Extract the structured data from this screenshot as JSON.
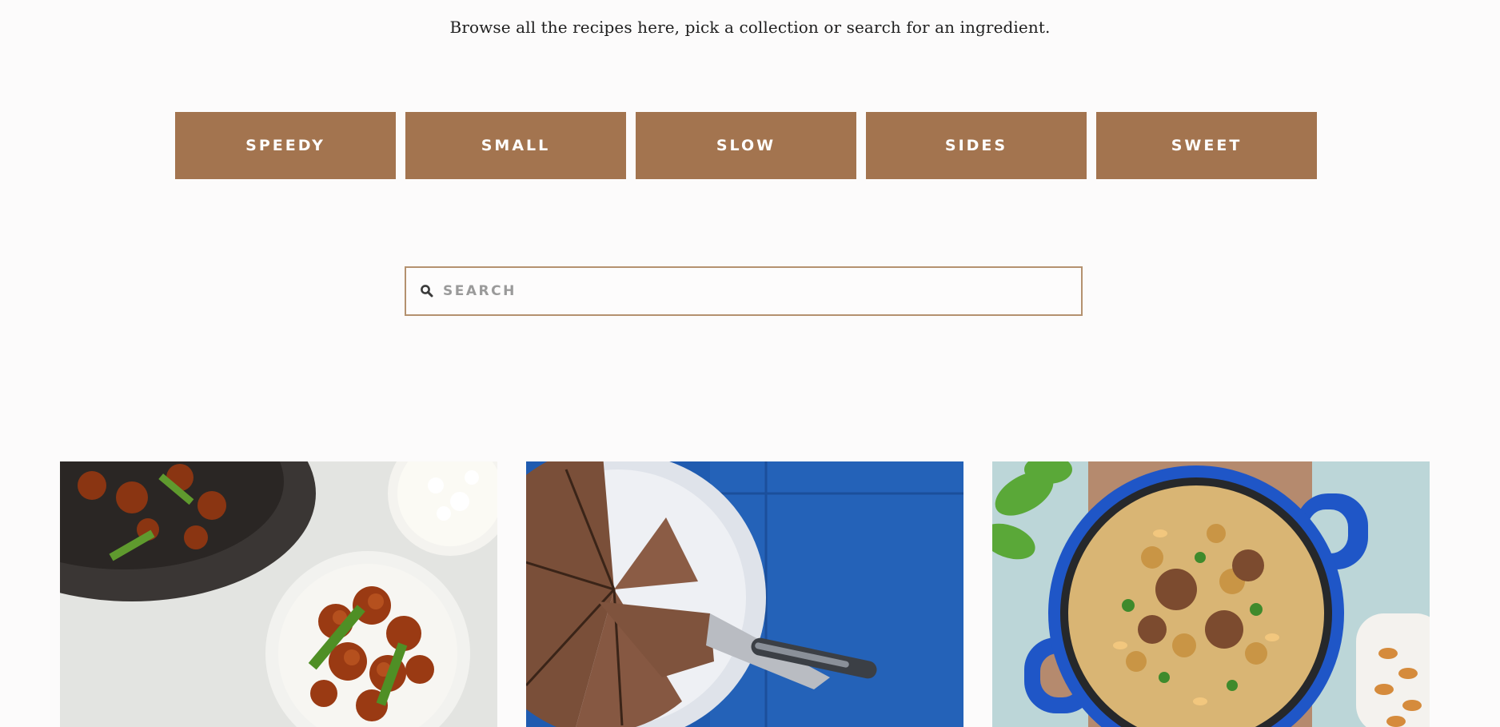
{
  "intro": {
    "text": "Browse all the recipes here, pick a collection or search for an ingredient."
  },
  "collections": [
    {
      "label": "SPEEDY"
    },
    {
      "label": "SMALL"
    },
    {
      "label": "SLOW"
    },
    {
      "label": "SIDES"
    },
    {
      "label": "SWEET"
    }
  ],
  "search": {
    "placeholder": "SEARCH",
    "value": "",
    "icon": "search-icon"
  },
  "colors": {
    "accent": "#a3744f",
    "search_border": "#b4916f",
    "background": "#fcfbfb"
  },
  "recipe_cards": [
    {
      "image": "sticky-chicken-with-rice-photo"
    },
    {
      "image": "chocolate-cake-slices-photo"
    },
    {
      "image": "rice-pilaf-in-blue-pot-photo"
    }
  ]
}
